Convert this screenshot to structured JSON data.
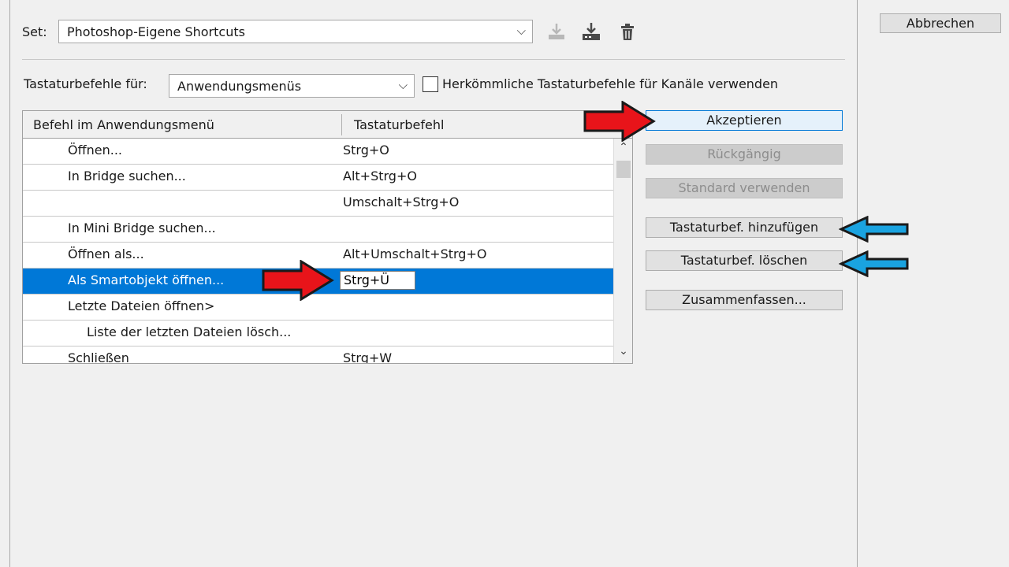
{
  "set": {
    "label": "Set:",
    "value": "Photoshop-Eigene Shortcuts"
  },
  "shortcuts_for": {
    "label": "Tastaturbefehle für:",
    "value": "Anwendungsmenüs"
  },
  "legacy_checkbox": {
    "label": "Herkömmliche Tastaturbefehle für Kanäle verwenden",
    "checked": false
  },
  "table": {
    "columns": [
      "Befehl im Anwendungsmenü",
      "Tastaturbefehl"
    ],
    "rows": [
      {
        "command": "Öffnen...",
        "shortcut": "Strg+O"
      },
      {
        "command": "In Bridge suchen...",
        "shortcut": "Alt+Strg+O"
      },
      {
        "command": "",
        "shortcut": "Umschalt+Strg+O"
      },
      {
        "command": "In Mini Bridge suchen...",
        "shortcut": ""
      },
      {
        "command": "Öffnen als...",
        "shortcut": "Alt+Umschalt+Strg+O"
      },
      {
        "command": "Als Smartobjekt öffnen...",
        "shortcut": "Strg+Ü",
        "selected": true
      },
      {
        "command": "Letzte Dateien öffnen>",
        "shortcut": ""
      },
      {
        "command": "Liste der letzten Dateien lösch...",
        "shortcut": ""
      },
      {
        "command": "Schließen",
        "shortcut": "Strg+W"
      }
    ]
  },
  "buttons": {
    "cancel": "Abbrechen",
    "accept": "Akzeptieren",
    "undo": "Rückgängig",
    "use_default": "Standard verwenden",
    "add_shortcut": "Tastaturbef. hinzufügen",
    "delete_shortcut": "Tastaturbef. löschen",
    "summarize": "Zusammenfassen..."
  },
  "icons": {
    "save_set": "save-set-icon",
    "save_set_as": "save-set-as-icon",
    "delete_set": "trash-icon",
    "dropdown": "chevron-down-icon",
    "scroll_up": "chevron-up-icon",
    "scroll_down": "chevron-down-icon"
  },
  "colors": {
    "selection": "#0078d7",
    "annotation_red": "#e8141a",
    "annotation_blue": "#1aa3e0"
  }
}
